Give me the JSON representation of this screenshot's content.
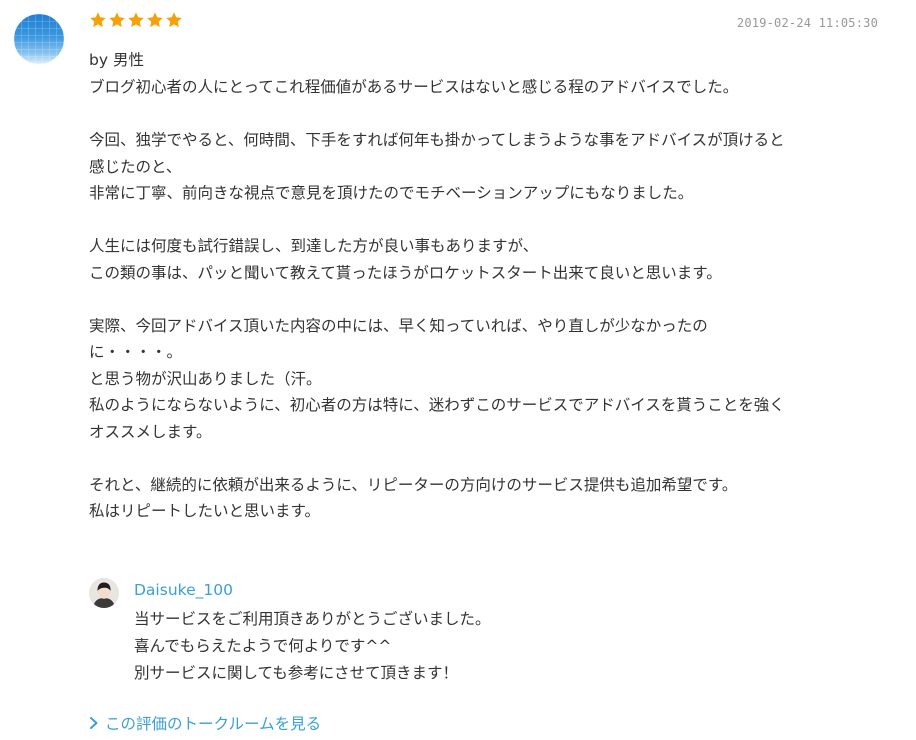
{
  "review": {
    "rating": 5,
    "max_rating": 5,
    "star_color": "#f5a20a",
    "timestamp": "2019-02-24 11:05:30",
    "author": "by 男性",
    "body": "ブログ初心者の人にとってこれ程価値があるサービスはないと感じる程のアドバイスでした。\n\n今回、独学でやると、何時間、下手をすれば何年も掛かってしまうような事をアドバイスが頂けると\n感じたのと、\n非常に丁寧、前向きな視点で意見を頂けたのでモチベーションアップにもなりました。\n\n人生には何度も試行錯誤し、到達した方が良い事もありますが、\nこの類の事は、パッと聞いて教えて貰ったほうがロケットスタート出来て良いと思います。\n\n実際、今回アドバイス頂いた内容の中には、早く知っていれば、やり直しが少なかったの\nに・・・・。\nと思う物が沢山ありました（汗。\n私のようにならないように、初心者の方は特に、迷わずこのサービスでアドバイスを貰うことを強く\nオススメします。\n\nそれと、継続的に依頼が出来るように、リピーターの方向けのサービス提供も追加希望です。\n私はリピートしたいと思います。"
  },
  "reply": {
    "name": "Daisuke_100",
    "name_color": "#3aa0d6",
    "body": "当サービスをご利用頂きありがとうございました。\n喜んでもらえたようで何よりです^^\n別サービスに関しても参考にさせて頂きます！"
  },
  "link": {
    "label": "この評価のトークルームを見る",
    "icon": "chevron-right-icon"
  }
}
